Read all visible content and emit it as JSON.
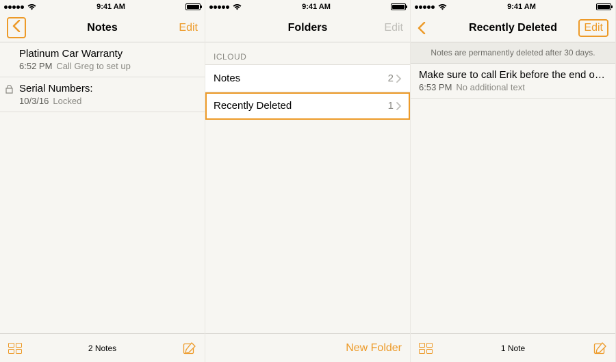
{
  "status": {
    "time": "9:41 AM"
  },
  "screen1": {
    "title": "Notes",
    "edit": "Edit",
    "notes": [
      {
        "title": "Platinum Car Warranty",
        "time": "6:52 PM",
        "snippet": "Call Greg to set up",
        "locked": false
      },
      {
        "title": "Serial Numbers:",
        "time": "10/3/16",
        "snippet": "Locked",
        "locked": true
      }
    ],
    "footer_count": "2 Notes"
  },
  "screen2": {
    "title": "Folders",
    "edit": "Edit",
    "section": "ICLOUD",
    "folders": [
      {
        "name": "Notes",
        "count": "2",
        "highlighted": false
      },
      {
        "name": "Recently Deleted",
        "count": "1",
        "highlighted": true
      }
    ],
    "new_folder": "New Folder"
  },
  "screen3": {
    "title": "Recently Deleted",
    "edit": "Edit",
    "banner": "Notes are permanently deleted after 30 days.",
    "notes": [
      {
        "title": "Make sure to call Erik before the end of the n...",
        "time": "6:53 PM",
        "snippet": "No additional text"
      }
    ],
    "footer_count": "1 Note"
  }
}
